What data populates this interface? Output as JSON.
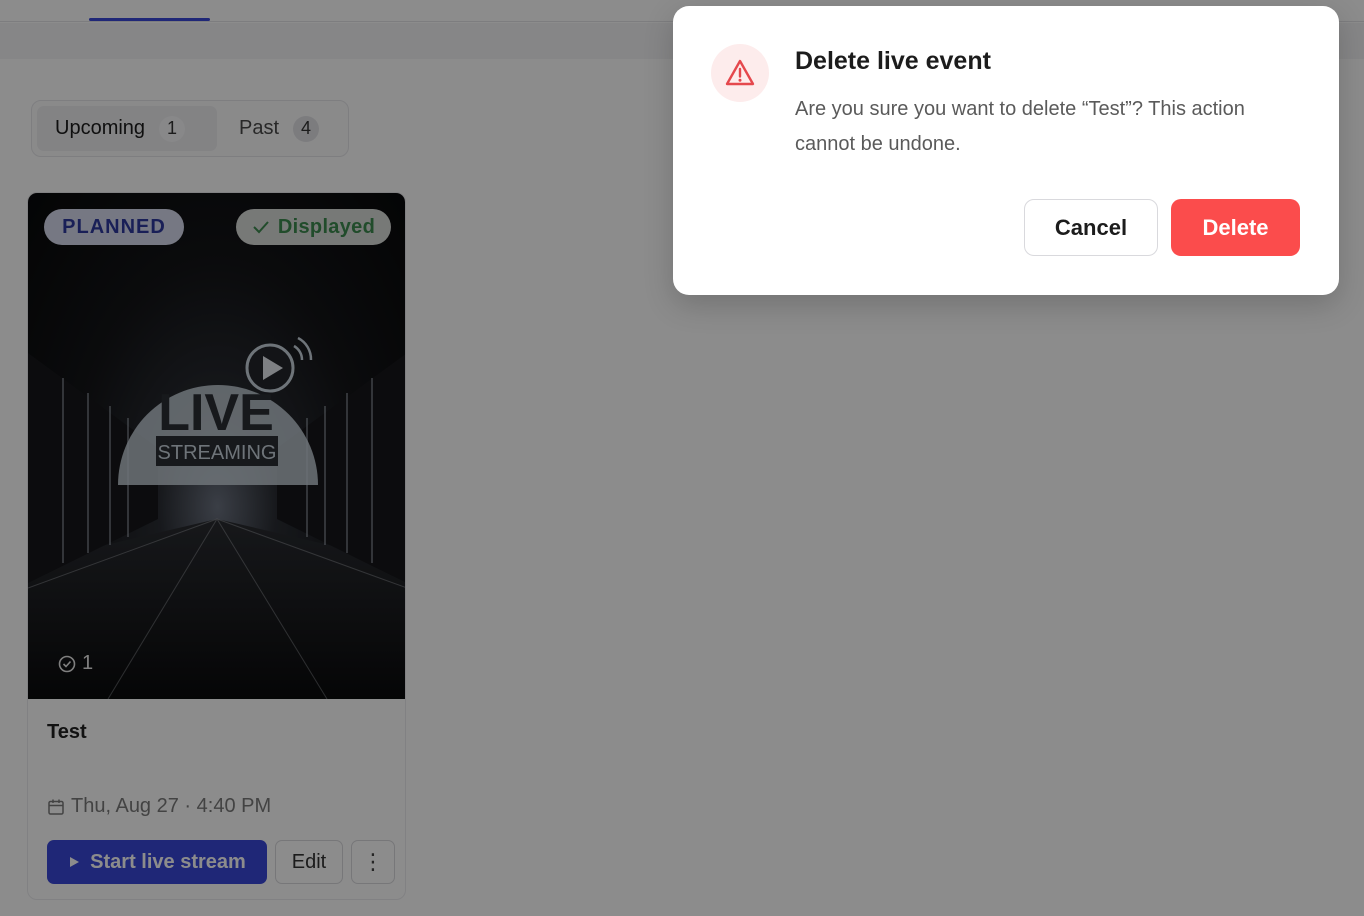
{
  "tabs": {
    "upcoming": {
      "label": "Upcoming",
      "count": "1"
    },
    "past": {
      "label": "Past",
      "count": "4"
    }
  },
  "event_card": {
    "status_badge": "PLANNED",
    "visibility_badge": "Displayed",
    "thumbnail_logo": {
      "word": "LIVE",
      "sub": "STREAMING"
    },
    "checkin_count": "1",
    "title": "Test",
    "date": "Thu, Aug 27 · 4:40 PM",
    "start_label": "Start live stream",
    "edit_label": "Edit",
    "more_label": "⋮"
  },
  "dialog": {
    "title": "Delete live event",
    "message": "Are you sure you want to delete “Test”? This action cannot be undone.",
    "cancel_label": "Cancel",
    "delete_label": "Delete"
  },
  "colors": {
    "accent": "#3a47d9",
    "danger": "#fb4c4c",
    "success": "#3d8a4f",
    "overlay": "rgba(0,0,0,0.45)"
  },
  "icons": [
    "warning-triangle-icon",
    "check-icon",
    "check-circle-icon",
    "calendar-icon",
    "play-icon",
    "more-vertical-icon",
    "broadcast-icon"
  ]
}
